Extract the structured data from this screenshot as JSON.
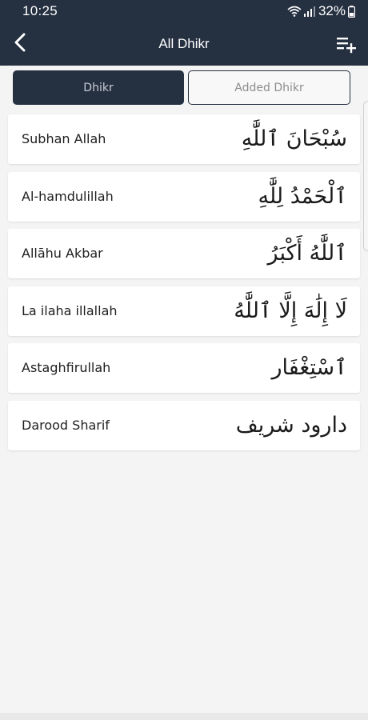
{
  "status_bar": {
    "time": "10:25",
    "battery": "32%",
    "icons": [
      "wifi-icon",
      "signal-icon",
      "battery-icon"
    ]
  },
  "app_bar": {
    "title": "All Dhikr",
    "back_icon": "chevron-left-icon",
    "action_icon": "playlist-add-icon"
  },
  "tabs": [
    {
      "label": "Dhikr",
      "active": true
    },
    {
      "label": "Added Dhikr",
      "active": false
    }
  ],
  "dhikr_list": [
    {
      "name": "Subhan Allah",
      "arabic": "سُبْحَانَ ٱللَّٰهِ"
    },
    {
      "name": "Al-hamdulillah",
      "arabic": "ٱلْحَمْدُ لِلَّٰهِ"
    },
    {
      "name": "Allāhu Akbar",
      "arabic": "ٱللَّٰهُ أَكْبَرُ"
    },
    {
      "name": "La ilaha illallah",
      "arabic": "لَا إِلَٰهَ إِلَّا ٱللَّٰهُ"
    },
    {
      "name": "Astaghfirullah",
      "arabic": "ٱسْتِغْفَار"
    },
    {
      "name": "Darood Sharif",
      "arabic": "دارود شريف"
    }
  ],
  "colors": {
    "primary": "#253041",
    "background": "#f4f4f4",
    "card": "#ffffff",
    "active_tab_text": "#c7ccd5",
    "inactive_tab_text": "#8d8d8d"
  }
}
